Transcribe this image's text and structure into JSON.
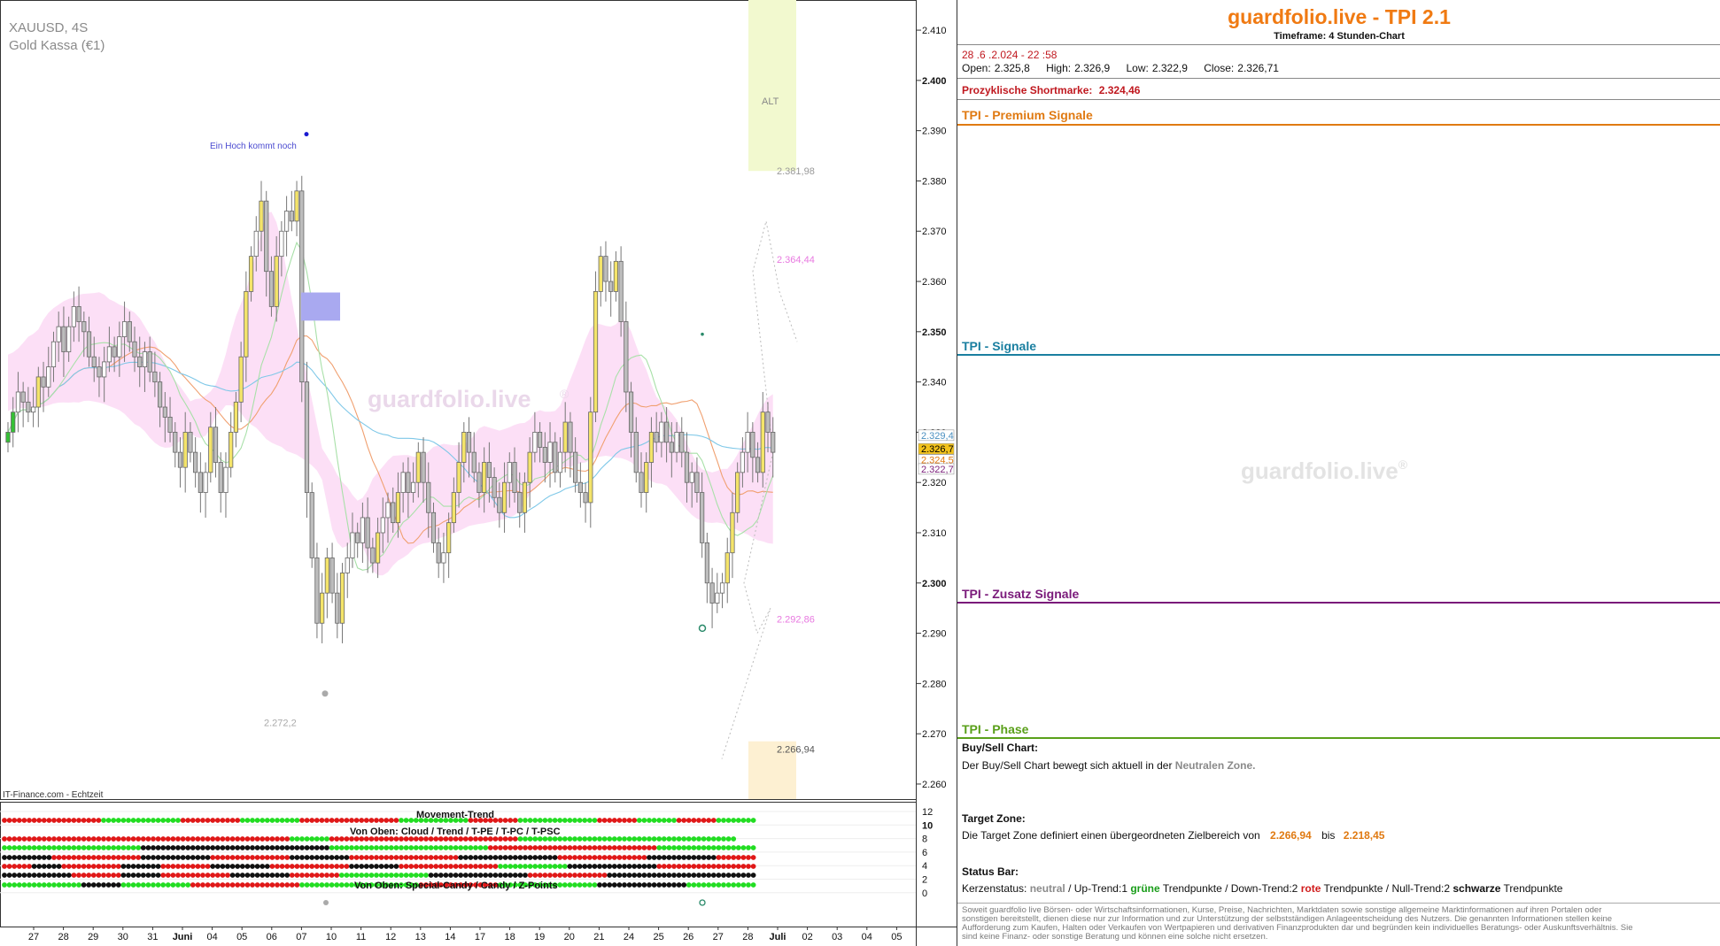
{
  "chart": {
    "symbol": "XAUUSD, 4S",
    "instrument": "Gold Kassa (€1)",
    "source": "IT-Finance.com - Echtzeit",
    "watermark": "guardfolio.live",
    "watermark_mark": "®",
    "annotation": "Ein Hoch kommt noch",
    "zone_label": "ALT",
    "level_labels": [
      {
        "text": "2.381,98",
        "value": 2381.98,
        "color": "#999999"
      },
      {
        "text": "2.364,44",
        "value": 2364.44,
        "color": "#e879e0"
      },
      {
        "text": "2.292,86",
        "value": 2292.86,
        "color": "#e879e0"
      },
      {
        "text": "2.272,2",
        "value": 2272.2,
        "color": "#aaaaaa"
      },
      {
        "text": "2.266,94",
        "value": 2266.94,
        "color": "#555555"
      }
    ],
    "price_tags": [
      {
        "text": "2.329,4",
        "value": 2329.4,
        "bg": "#ffffff",
        "fg": "#4a8fc0"
      },
      {
        "text": "2.326,7",
        "value": 2326.7,
        "bg": "#f2c21a",
        "fg": "#000000"
      },
      {
        "text": "2.324,5",
        "value": 2324.5,
        "bg": "#ffffff",
        "fg": "#e07a12"
      },
      {
        "text": "2.322,7",
        "value": 2322.7,
        "bg": "#ffffff",
        "fg": "#7a1f7a"
      }
    ]
  },
  "chart_data": {
    "type": "candlestick",
    "y_axis": {
      "ticks": [
        "2.410",
        "2.400",
        "2.390",
        "2.380",
        "2.370",
        "2.360",
        "2.350",
        "2.340",
        "2.330",
        "2.320",
        "2.310",
        "2.300",
        "2.290",
        "2.280",
        "2.270",
        "2.260"
      ],
      "tick_values": [
        2410,
        2400,
        2390,
        2380,
        2370,
        2360,
        2350,
        2340,
        2330,
        2320,
        2310,
        2300,
        2290,
        2280,
        2270,
        2260
      ],
      "bold_ticks": [
        "2.400",
        "2.350",
        "2.300"
      ],
      "range": [
        2257,
        2416
      ]
    },
    "x_axis": {
      "ticks": [
        "27",
        "28",
        "29",
        "30",
        "31",
        "Juni",
        "04",
        "05",
        "06",
        "07",
        "10",
        "11",
        "12",
        "13",
        "14",
        "17",
        "18",
        "19",
        "20",
        "21",
        "24",
        "25",
        "26",
        "27",
        "28",
        "Juli",
        "02",
        "03",
        "04",
        "05"
      ],
      "bold_ticks": [
        "Juni",
        "Juli"
      ]
    },
    "close": [
      2330,
      2334,
      2338,
      2336,
      2334,
      2335,
      2341,
      2339,
      2343,
      2348,
      2351,
      2346,
      2351,
      2355,
      2352,
      2350,
      2345,
      2343,
      2341,
      2344,
      2347,
      2345,
      2349,
      2352,
      2348,
      2345,
      2343,
      2346,
      2342,
      2340,
      2335,
      2333,
      2330,
      2326,
      2323,
      2330,
      2326,
      2322,
      2318,
      2322,
      2331,
      2324,
      2318,
      2323,
      2330,
      2336,
      2345,
      2358,
      2365,
      2370,
      2376,
      2362,
      2355,
      2365,
      2370,
      2374,
      2372,
      2378,
      2340,
      2318,
      2305,
      2292,
      2298,
      2305,
      2298,
      2292,
      2302,
      2305,
      2310,
      2308,
      2313,
      2307,
      2304,
      2310,
      2313,
      2316,
      2312,
      2318,
      2322,
      2318,
      2320,
      2326,
      2320,
      2314,
      2308,
      2304,
      2306,
      2312,
      2318,
      2324,
      2330,
      2326,
      2322,
      2318,
      2324,
      2321,
      2317,
      2314,
      2320,
      2324,
      2318,
      2314,
      2320,
      2326,
      2330,
      2327,
      2324,
      2328,
      2322,
      2326,
      2332,
      2326,
      2320,
      2318,
      2316,
      2334,
      2358,
      2365,
      2360,
      2358,
      2364,
      2352,
      2338,
      2330,
      2322,
      2318,
      2324,
      2330,
      2328,
      2332,
      2328,
      2326,
      2330,
      2326,
      2320,
      2322,
      2318,
      2308,
      2300,
      2296,
      2298,
      2300,
      2306,
      2314,
      2322,
      2326,
      2330,
      2325,
      2322,
      2334,
      2330,
      2326
    ],
    "movement_trend_label": "Movement-Trend",
    "indicator_label_top": "Von Oben: Cloud / Trend / T-PE / T-PC / T-PSC",
    "indicator_label_bottom": "Von Oben: Special-Candy / Candy / Z-Points",
    "indicator_y_ticks": [
      "12",
      "10",
      "8",
      "6",
      "4",
      "2",
      "0"
    ],
    "indicator_rows": [
      [
        [
          "r",
          20
        ],
        [
          "g",
          16
        ],
        [
          "r",
          12
        ],
        [
          "g",
          12
        ],
        [
          "r",
          20
        ],
        [
          "g",
          14
        ],
        [
          "r",
          10
        ],
        [
          "g",
          16
        ],
        [
          "r",
          8
        ],
        [
          "g",
          8
        ],
        [
          "r",
          8
        ],
        [
          "g",
          8
        ]
      ],
      [
        [
          "r",
          58
        ],
        [
          "g",
          8
        ],
        [
          "r",
          38
        ],
        [
          "g",
          44
        ]
      ],
      [
        [
          "g",
          28
        ],
        [
          "k",
          38
        ],
        [
          "g",
          32
        ],
        [
          "r",
          34
        ],
        [
          "g",
          20
        ]
      ],
      [
        [
          "k",
          10
        ],
        [
          "r",
          18
        ],
        [
          "k",
          14
        ],
        [
          "r",
          16
        ],
        [
          "k",
          12
        ],
        [
          "r",
          22
        ],
        [
          "k",
          20
        ],
        [
          "r",
          18
        ],
        [
          "k",
          14
        ],
        [
          "r",
          8
        ]
      ],
      [
        [
          "r",
          6
        ],
        [
          "k",
          6
        ],
        [
          "r",
          12
        ],
        [
          "k",
          8
        ],
        [
          "r",
          10
        ],
        [
          "k",
          12
        ],
        [
          "r",
          16
        ],
        [
          "k",
          10
        ],
        [
          "r",
          20
        ],
        [
          "g",
          14
        ],
        [
          "k",
          18
        ],
        [
          "r",
          20
        ]
      ],
      [
        [
          "k",
          14
        ],
        [
          "r",
          10
        ],
        [
          "k",
          8
        ],
        [
          "r",
          14
        ],
        [
          "k",
          12
        ],
        [
          "r",
          10
        ],
        [
          "g",
          18
        ],
        [
          "k",
          20
        ],
        [
          "r",
          16
        ],
        [
          "k",
          30
        ]
      ],
      [
        [
          "g",
          16
        ],
        [
          "k",
          8
        ],
        [
          "g",
          14
        ],
        [
          "r",
          22
        ],
        [
          "g",
          24
        ],
        [
          "r",
          16
        ],
        [
          "g",
          20
        ],
        [
          "k",
          18
        ],
        [
          "g",
          14
        ]
      ]
    ]
  },
  "panel": {
    "brand": "guardfolio.live - TPI 2.1",
    "timeframe": "Timeframe: 4 Stunden-Chart",
    "datetime": "28 .6 .2.024 - 22 :58",
    "open_label": "Open:",
    "open": "2.325,8",
    "high_label": "High:",
    "high": "2.326,9",
    "low_label": "Low:",
    "low": "2.322,9",
    "close_label": "Close:",
    "close": "2.326,71",
    "shortmark_label": "Prozyklische Shortmarke:",
    "shortmark": "2.324,46",
    "signals": [
      {
        "label": "TPI - Premium Signale",
        "color": "#e07a12"
      },
      {
        "label": "TPI - Signale",
        "color": "#1a7fa0"
      },
      {
        "label": "TPI - Zusatz Signale",
        "color": "#7a1a7a"
      },
      {
        "label": "TPI - Phase",
        "color": "#5aa01a"
      }
    ],
    "buysell_h": "Buy/Sell Chart:",
    "buysell_t1": "Der Buy/Sell Chart bewegt sich aktuell in der",
    "buysell_zone": "Neutralen Zone.",
    "target_h": "Target Zone:",
    "target_t1": "Die Target Zone definiert einen übergeordneten Zielbereich von",
    "target_a": "2.266,94",
    "target_bis": "bis",
    "target_b": "2.218,45",
    "status_h": "Status Bar:",
    "status_k": "Kerzenstatus:",
    "status_neutral": "neutral",
    "status_up": "/ Up-Trend:1",
    "status_gruene": "grüne",
    "status_tp1": "Trendpunkte",
    "status_down": "/ Down-Trend:2",
    "status_rote": "rote",
    "status_tp2": "Trendpunkte",
    "status_null": "/ Null-Trend:2",
    "status_schwarze": "schwarze",
    "status_tp3": "Trendpunkte",
    "disclaimer": "Soweit guardfolio live Börsen- oder Wirtschaftsinformationen, Kurse, Preise, Nachrichten, Marktdaten sowie sonstige allgemeine Marktinformationen auf ihren Portalen oder sonstigen bereitstellt, dienen diese nur zur Information und zur Unterstützung der selbstständigen Anlageentscheidung des Nutzers. Die genannten Informationen stellen keine Aufforderung zum Kaufen, Halten oder Verkaufen von Wertpapieren und derivativen Finanzprodukten dar und begründen kein individuelles Beratungs- oder Auskunftsverhältnis. Sie sind keine Finanz- oder sonstige Beratung und können eine solche nicht ersetzen."
  }
}
